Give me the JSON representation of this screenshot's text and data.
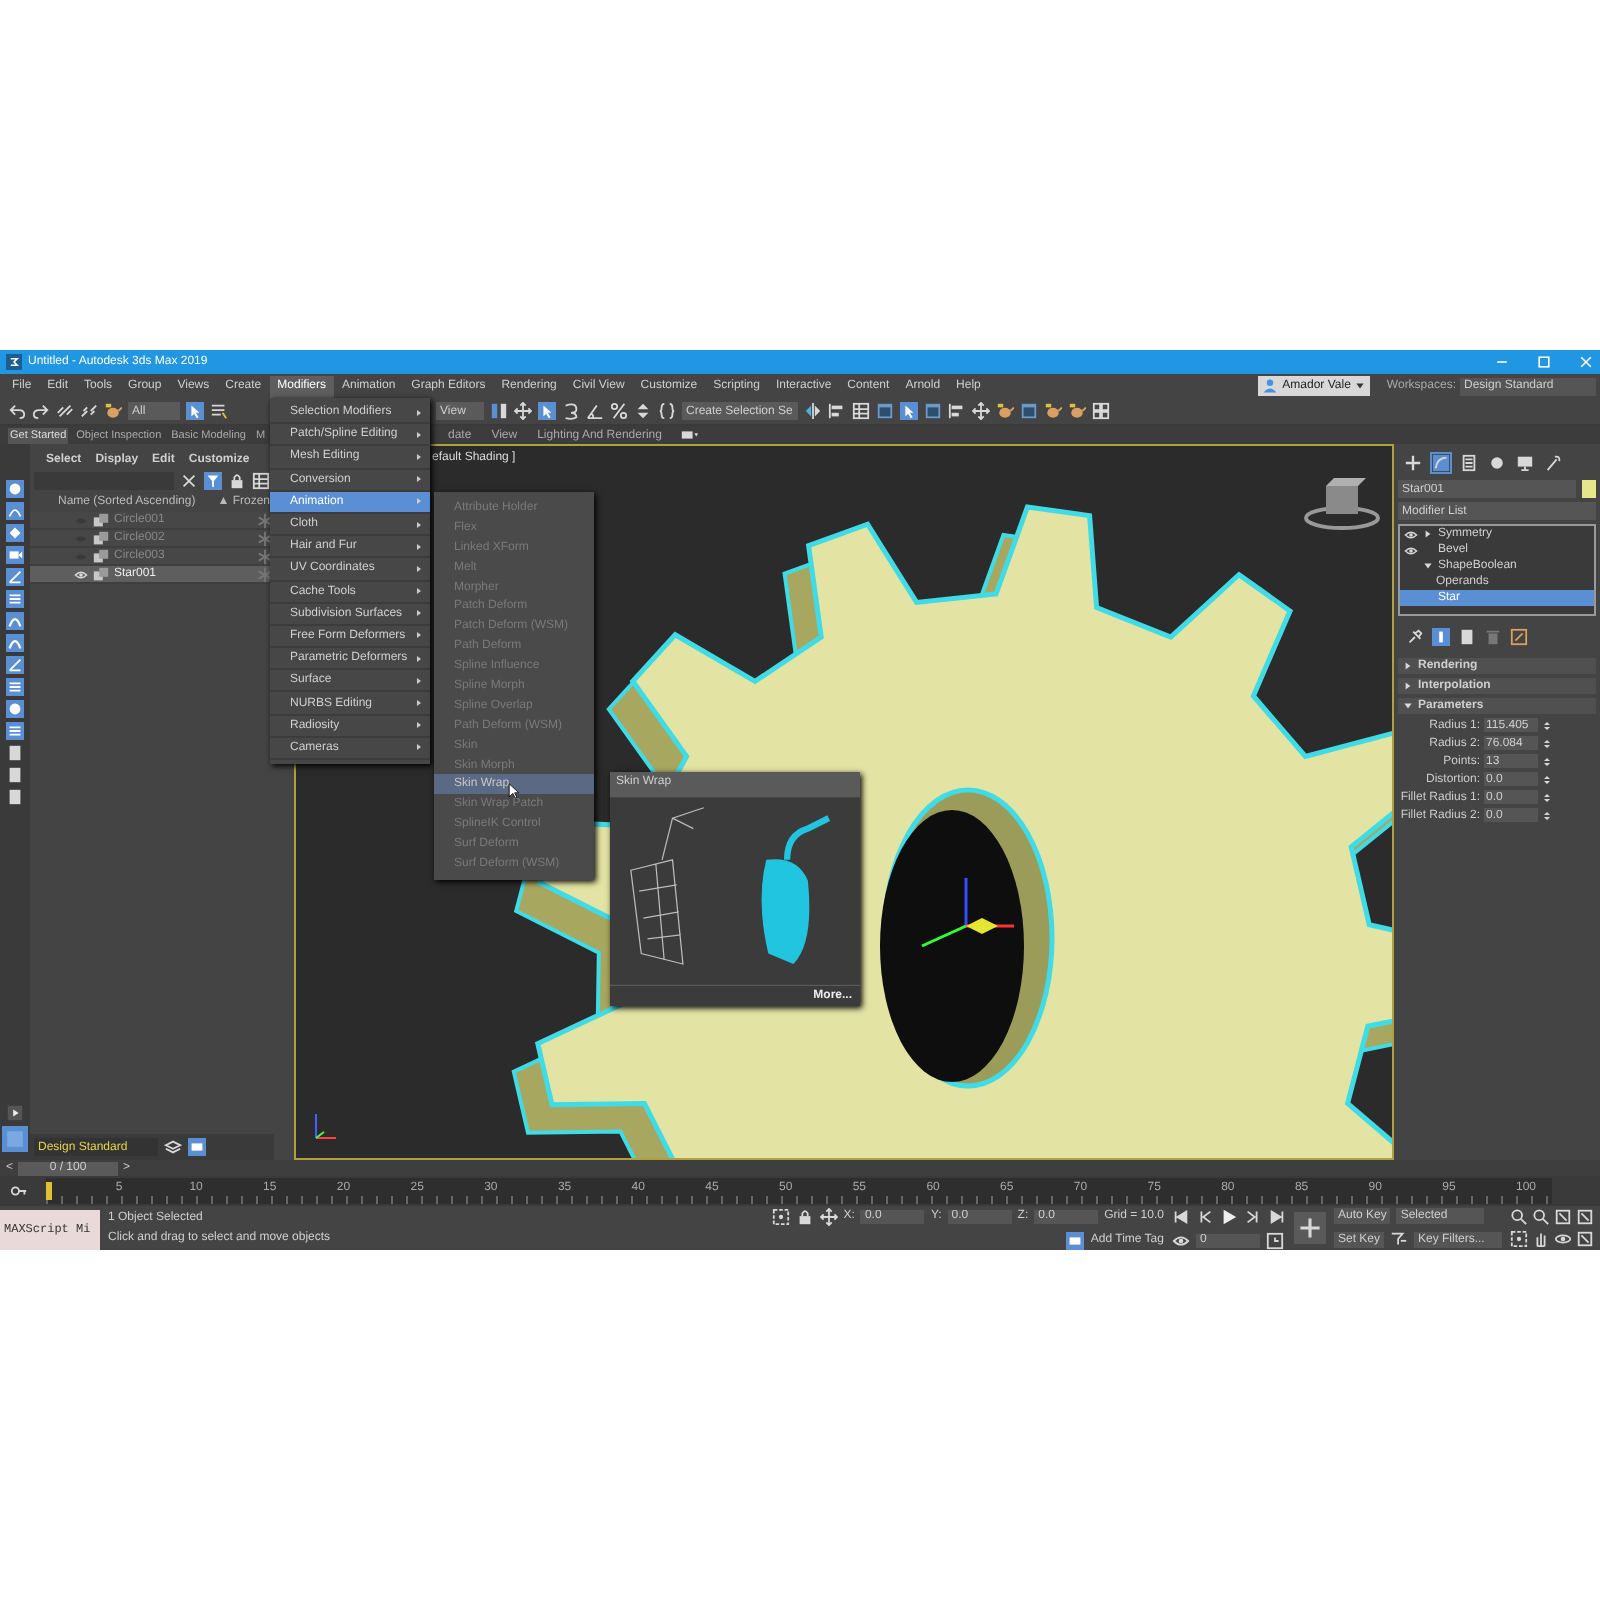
{
  "window": {
    "title": "Untitled - Autodesk 3ds Max 2019"
  },
  "menu_bar": [
    {
      "label": "File",
      "selected": false
    },
    {
      "label": "Edit",
      "selected": false
    },
    {
      "label": "Tools",
      "selected": false
    },
    {
      "label": "Group",
      "selected": false
    },
    {
      "label": "Views",
      "selected": false
    },
    {
      "label": "Create",
      "selected": false
    },
    {
      "label": "Modifiers",
      "selected": true
    },
    {
      "label": "Animation",
      "selected": false
    },
    {
      "label": "Graph Editors",
      "selected": false
    },
    {
      "label": "Rendering",
      "selected": false
    },
    {
      "label": "Civil View",
      "selected": false
    },
    {
      "label": "Customize",
      "selected": false
    },
    {
      "label": "Scripting",
      "selected": false
    },
    {
      "label": "Interactive",
      "selected": false
    },
    {
      "label": "Content",
      "selected": false
    },
    {
      "label": "Arnold",
      "selected": false
    },
    {
      "label": "Help",
      "selected": false
    }
  ],
  "account": {
    "user": "Amador Vale",
    "workspace_label": "Workspaces:",
    "workspace": "Design Standard"
  },
  "main_toolbar": {
    "selection_filter": "All",
    "reference_coordinate": "View",
    "named_selection": "Create Selection Se"
  },
  "ribbon_tabs": [
    {
      "label": "Get Started",
      "selected": true
    },
    {
      "label": "Object Inspection",
      "selected": false
    },
    {
      "label": "Basic Modeling",
      "selected": false
    },
    {
      "label": "M",
      "selected": false
    },
    {
      "label": "date",
      "selected": false
    },
    {
      "label": "View",
      "selected": false
    },
    {
      "label": "Lighting And Rendering",
      "selected": false
    }
  ],
  "scene_explorer": {
    "tabs": [
      "Select",
      "Display",
      "Edit",
      "Customize"
    ],
    "columns": [
      "Name (Sorted Ascending)",
      "▲ Frozen"
    ],
    "rows": [
      {
        "name": "Circle001",
        "hidden": true,
        "selected": false
      },
      {
        "name": "Circle002",
        "hidden": true,
        "selected": false
      },
      {
        "name": "Circle003",
        "hidden": true,
        "selected": false
      },
      {
        "name": "Star001",
        "hidden": false,
        "selected": true
      }
    ],
    "workspace": "Design Standard"
  },
  "viewport": {
    "label": "efault Shading ]"
  },
  "modifiers_menu": [
    {
      "label": "Selection Modifiers",
      "selected": false
    },
    {
      "label": "Patch/Spline Editing",
      "selected": false
    },
    {
      "label": "Mesh Editing",
      "selected": false
    },
    {
      "label": "Conversion",
      "selected": false
    },
    {
      "label": "Animation",
      "selected": true
    },
    {
      "label": "Cloth",
      "selected": false
    },
    {
      "label": "Hair and Fur",
      "selected": false
    },
    {
      "label": "UV Coordinates",
      "selected": false
    },
    {
      "label": "Cache Tools",
      "selected": false
    },
    {
      "label": "Subdivision Surfaces",
      "selected": false
    },
    {
      "label": "Free Form Deformers",
      "selected": false
    },
    {
      "label": "Parametric Deformers",
      "selected": false
    },
    {
      "label": "Surface",
      "selected": false
    },
    {
      "label": "NURBS Editing",
      "selected": false
    },
    {
      "label": "Radiosity",
      "selected": false
    },
    {
      "label": "Cameras",
      "selected": false
    }
  ],
  "animation_submenu": [
    {
      "label": "Attribute Holder",
      "disabled": true,
      "selected": false
    },
    {
      "label": "Flex",
      "disabled": true,
      "selected": false
    },
    {
      "label": "Linked XForm",
      "disabled": true,
      "selected": false
    },
    {
      "label": "Melt",
      "disabled": true,
      "selected": false
    },
    {
      "label": "Morpher",
      "disabled": true,
      "selected": false
    },
    {
      "label": "Patch Deform",
      "disabled": true,
      "selected": false
    },
    {
      "label": "Patch Deform (WSM)",
      "disabled": true,
      "selected": false
    },
    {
      "label": "Path Deform",
      "disabled": true,
      "selected": false
    },
    {
      "label": "Spline Influence",
      "disabled": true,
      "selected": false
    },
    {
      "label": "Spline Morph",
      "disabled": true,
      "selected": false
    },
    {
      "label": "Spline Overlap",
      "disabled": true,
      "selected": false
    },
    {
      "label": "Path Deform (WSM)",
      "disabled": true,
      "selected": false
    },
    {
      "label": "Skin",
      "disabled": true,
      "selected": false
    },
    {
      "label": "Skin Morph",
      "disabled": true,
      "selected": false
    },
    {
      "label": "Skin Wrap",
      "disabled": true,
      "selected": true
    },
    {
      "label": "Skin Wrap Patch",
      "disabled": true,
      "selected": false
    },
    {
      "label": "SplineIK Control",
      "disabled": true,
      "selected": false
    },
    {
      "label": "Surf Deform",
      "disabled": true,
      "selected": false
    },
    {
      "label": "Surf Deform (WSM)",
      "disabled": true,
      "selected": false
    }
  ],
  "tooltip": {
    "title": "Skin Wrap",
    "link": "More..."
  },
  "command_panel": {
    "tabs": [
      {
        "kind": "create",
        "selected": false
      },
      {
        "kind": "modify",
        "selected": true
      },
      {
        "kind": "hierarchy",
        "selected": false
      },
      {
        "kind": "motion",
        "selected": false
      },
      {
        "kind": "display",
        "selected": false
      },
      {
        "kind": "utilities",
        "selected": false
      }
    ],
    "object_name": "Star001",
    "modifier_list": "Modifier List",
    "stack": [
      {
        "label": "Symmetry",
        "visible": true,
        "expanded": false,
        "selected": false
      },
      {
        "label": "Bevel",
        "visible": true,
        "selected": false
      },
      {
        "label": "ShapeBoolean",
        "visible": false,
        "expanded": true,
        "selected": false,
        "children": [
          {
            "label": "Operands",
            "selected": false
          }
        ]
      },
      {
        "label": "Star",
        "visible": false,
        "selected": true
      }
    ],
    "rollouts": [
      {
        "title": "Rendering",
        "expanded": false
      },
      {
        "title": "Interpolation",
        "expanded": false
      },
      {
        "title": "Parameters",
        "expanded": true,
        "fields": [
          {
            "label": "Radius 1:",
            "value": "115.405"
          },
          {
            "label": "Radius 2:",
            "value": "76.084"
          },
          {
            "label": "Points:",
            "value": "13"
          },
          {
            "label": "Distortion:",
            "value": "0.0"
          },
          {
            "label": "Fillet Radius 1:",
            "value": "0.0"
          },
          {
            "label": "Fillet Radius 2:",
            "value": "0.0"
          }
        ]
      }
    ]
  },
  "time_slider": {
    "label": "0 / 100",
    "level": 0,
    "prev": "<",
    "next": ">"
  },
  "timeline": {
    "ticks": [
      "5",
      "10",
      "15",
      "20",
      "25",
      "30",
      "35",
      "40",
      "45",
      "50",
      "55",
      "60",
      "65",
      "70",
      "75",
      "80",
      "85",
      "90",
      "95",
      "100"
    ]
  },
  "status_bar": {
    "maxscript": "MAXScript Mi",
    "status": "1 Object Selected",
    "prompt": "Click and drag to select and move objects",
    "coords": [
      {
        "axis": "X:",
        "value": "0.0"
      },
      {
        "axis": "Y:",
        "value": "0.0"
      },
      {
        "axis": "Z:",
        "value": "0.0"
      }
    ],
    "grid": "Grid = 10.0",
    "time_tag": "Add Time Tag",
    "frame": "0",
    "auto_key": "Auto Key",
    "key_mode": "Selected",
    "set_key": "Set Key",
    "key_filters": "Key Filters..."
  }
}
